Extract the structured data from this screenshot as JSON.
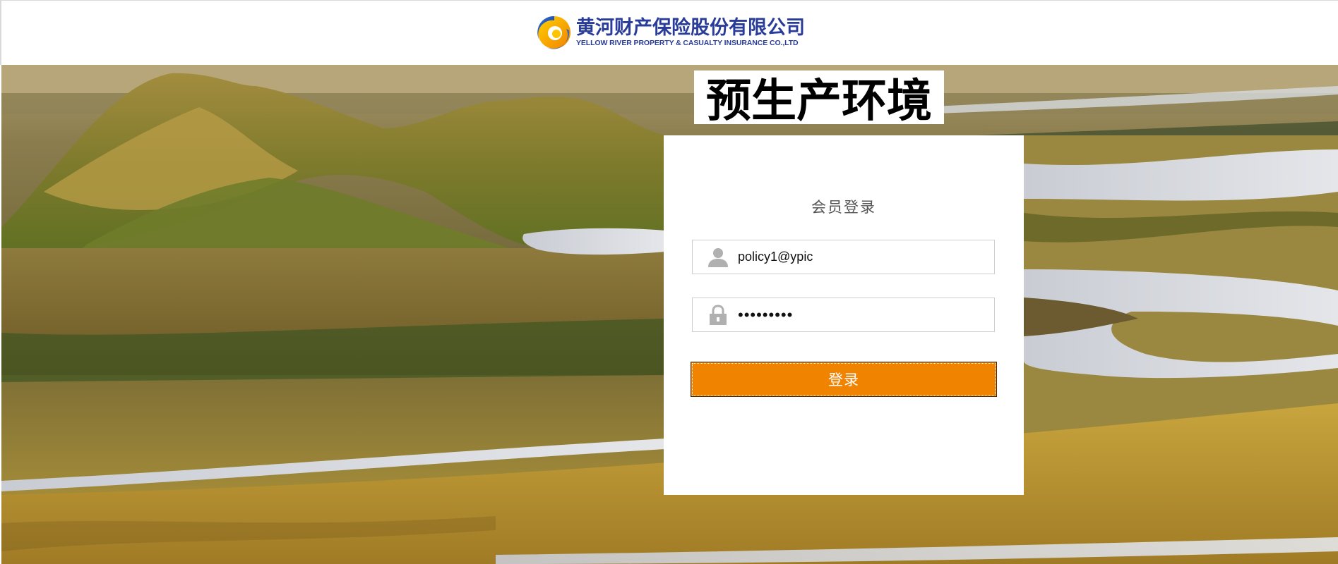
{
  "header": {
    "logo_cn": "黄河财产保险股份有限公司",
    "logo_en": "YELLOW RIVER PROPERTY & CASUALTY INSURANCE CO.,LTD",
    "logo_icon": "ypic-logo-icon",
    "brand_color": "#2a3c9a"
  },
  "banner": {
    "environment_label": "预生产环境"
  },
  "login": {
    "title": "会员登录",
    "username": {
      "icon": "user-icon",
      "value": "policy1@ypic"
    },
    "password": {
      "icon": "lock-icon",
      "value": "•••••••••"
    },
    "submit_label": "登录",
    "button_color": "#f08300"
  },
  "background": {
    "description_icon": "landscape-image"
  }
}
